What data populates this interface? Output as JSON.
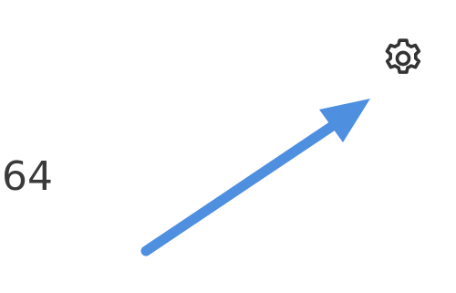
{
  "display": {
    "value": "64"
  },
  "icons": {
    "settings": "gear-icon"
  },
  "annotation": {
    "type": "arrow",
    "color": "#4e8fe0"
  },
  "colors": {
    "text": "#3a3a3a",
    "icon": "#333333",
    "arrow": "#4e8fe0",
    "background": "#ffffff"
  }
}
